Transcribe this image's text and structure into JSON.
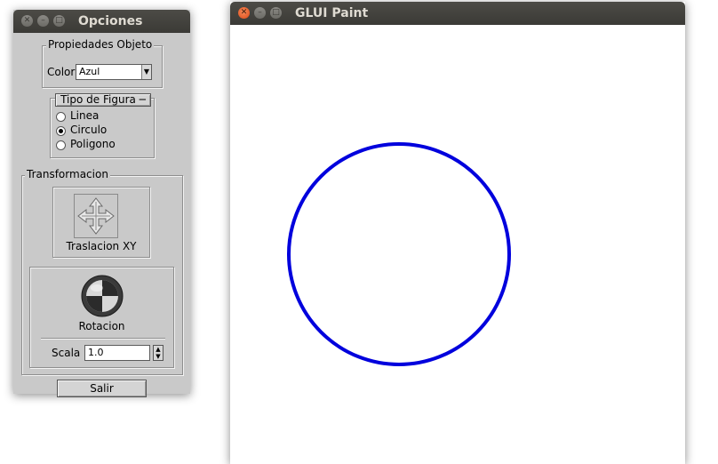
{
  "opciones_window": {
    "title": "Opciones",
    "propiedades": {
      "legend": "Propiedades Objeto",
      "color_label": "Color",
      "color_value": "Azul"
    },
    "tipo_figura": {
      "legend": "Tipo de Figura ─",
      "options": [
        {
          "label": "Linea",
          "checked": false
        },
        {
          "label": "Circulo",
          "checked": true
        },
        {
          "label": "Poligono",
          "checked": false
        }
      ]
    },
    "transformacion": {
      "legend": "Transformacion",
      "traslacion_label": "Traslacion XY",
      "rotacion_label": "Rotacion",
      "scala_label": "Scala",
      "scala_value": "1.0"
    },
    "salir_label": "Salir"
  },
  "paint_window": {
    "title": "GLUI Paint",
    "shape": "circle",
    "stroke_color": "#0000dd"
  },
  "colors": {
    "titlebar": "#3c3b37",
    "panel": "#c9c9c9",
    "close_button": "#dd4814",
    "shape_stroke": "#0000dd"
  }
}
